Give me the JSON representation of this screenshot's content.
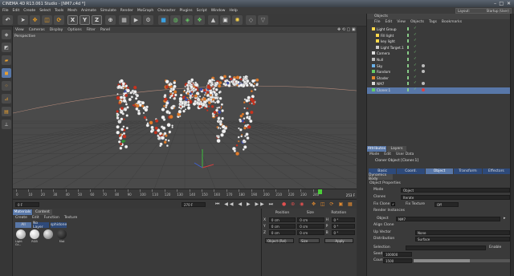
{
  "app": {
    "title": "CINEMA 4D R13.061 Studio - [NM7.c4d *]",
    "layout_label": "Layout:",
    "layout_value": "Startup (User)"
  },
  "menu": [
    "File",
    "Edit",
    "Create",
    "Select",
    "Tools",
    "Mesh",
    "Animate",
    "Simulate",
    "Render",
    "MoGraph",
    "Character",
    "Plugins",
    "Script",
    "Window",
    "Help"
  ],
  "toolbar": {
    "axis_x": "X",
    "axis_y": "Y",
    "axis_z": "Z"
  },
  "viewport": {
    "menu": [
      "View",
      "Cameras",
      "Display",
      "Options",
      "Filter",
      "Panel"
    ],
    "label": "Perspective"
  },
  "timeline": {
    "ticks": [
      "0",
      "10",
      "20",
      "30",
      "40",
      "50",
      "60",
      "70",
      "80",
      "90",
      "100",
      "110",
      "120",
      "130",
      "140",
      "150",
      "160",
      "170",
      "180",
      "190",
      "200",
      "210",
      "220",
      "230",
      "240"
    ],
    "frame_badge": "253 F"
  },
  "transport": {
    "start": "0 F",
    "end": "270 F"
  },
  "materials": {
    "tabs": [
      "Materials",
      "Content"
    ],
    "menu": [
      "Create",
      "Edit",
      "Function",
      "Texture"
    ],
    "filters": [
      "All",
      "No Layer",
      "sphidone"
    ],
    "items": [
      "Light Gr...",
      "RGB",
      "",
      "Mat"
    ]
  },
  "coords": {
    "headers": [
      "Position",
      "Size",
      "Rotation"
    ],
    "rows": [
      {
        "axis": "X",
        "pos": "0 cm",
        "size": "0 cm",
        "rot_axis": "H",
        "rot": "0 °"
      },
      {
        "axis": "Y",
        "pos": "0 cm",
        "size": "0 cm",
        "rot_axis": "P",
        "rot": "0 °"
      },
      {
        "axis": "Z",
        "pos": "0 cm",
        "size": "0 cm",
        "rot_axis": "B",
        "rot": "0 °"
      }
    ],
    "mode_select": "Object (Rel)",
    "size_select": "Size",
    "apply_label": "Apply"
  },
  "objects": {
    "title": "Objects",
    "menu": [
      "File",
      "Edit",
      "View",
      "Objects",
      "Tags",
      "Bookmarks"
    ],
    "items": [
      {
        "name": "Light Group",
        "indent": 0,
        "sel": false
      },
      {
        "name": "Fill light",
        "indent": 1,
        "sel": false
      },
      {
        "name": "key light",
        "indent": 1,
        "sel": false
      },
      {
        "name": "Light Target.1",
        "indent": 1,
        "sel": false
      },
      {
        "name": "Camera",
        "indent": 0,
        "sel": false
      },
      {
        "name": "Null",
        "indent": 0,
        "sel": false
      },
      {
        "name": "Sky",
        "indent": 0,
        "sel": false
      },
      {
        "name": "Random",
        "indent": 0,
        "sel": false
      },
      {
        "name": "Shader",
        "indent": 0,
        "sel": false
      },
      {
        "name": "NM7",
        "indent": 0,
        "sel": false
      },
      {
        "name": "Cloner.1",
        "indent": 0,
        "sel": true
      }
    ]
  },
  "attributes": {
    "tabs": [
      "Attributes",
      "Layers"
    ],
    "menu": [
      "Mode",
      "Edit",
      "User Data"
    ],
    "object_title": "Cloner Object [Cloner.1]",
    "tabs_row": [
      "Basic",
      "Coord.",
      "Object",
      "Transform",
      "Effectors"
    ],
    "extra_tab": "Dynamics Body",
    "section": "Object Properties",
    "mode_label": "Mode",
    "mode_value": "Object",
    "clones_label": "Clones",
    "clones_value": "Iterate",
    "fix_clone_label": "Fix Clone",
    "fix_texture_label": "Fix Texture",
    "fix_texture_value": "Off",
    "render_instances_label": "Render Instances",
    "object_label": "Object",
    "object_value": "NM7",
    "align_clone_label": "Align Clone",
    "up_vector_label": "Up Vector",
    "up_vector_value": "None",
    "distribution_label": "Distribution",
    "distribution_value": "Surface",
    "selection_label": "Selection",
    "enable_label": "Enable",
    "seed_label": "Seed",
    "seed_value": "100000",
    "count_label": "Count",
    "count_value": "1500"
  },
  "colors": {
    "accent": "#5877a8",
    "panel": "#3a3a3a",
    "viewport": "#4a4a4a",
    "timeline_marker": "#4ccf3a"
  }
}
